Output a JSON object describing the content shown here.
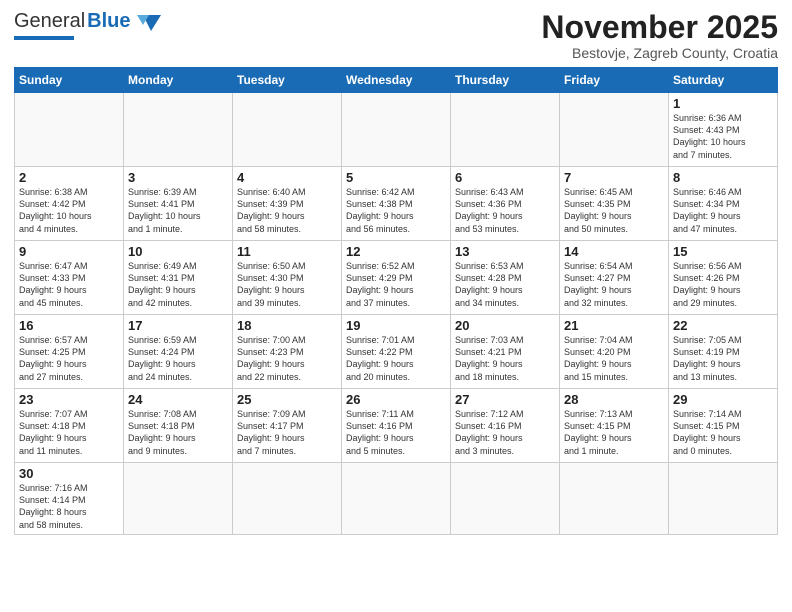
{
  "header": {
    "logo_general": "General",
    "logo_blue": "Blue",
    "month_title": "November 2025",
    "location": "Bestovje, Zagreb County, Croatia"
  },
  "days_of_week": [
    "Sunday",
    "Monday",
    "Tuesday",
    "Wednesday",
    "Thursday",
    "Friday",
    "Saturday"
  ],
  "weeks": [
    [
      {
        "day": "",
        "info": ""
      },
      {
        "day": "",
        "info": ""
      },
      {
        "day": "",
        "info": ""
      },
      {
        "day": "",
        "info": ""
      },
      {
        "day": "",
        "info": ""
      },
      {
        "day": "",
        "info": ""
      },
      {
        "day": "1",
        "info": "Sunrise: 6:36 AM\nSunset: 4:43 PM\nDaylight: 10 hours\nand 7 minutes."
      }
    ],
    [
      {
        "day": "2",
        "info": "Sunrise: 6:38 AM\nSunset: 4:42 PM\nDaylight: 10 hours\nand 4 minutes."
      },
      {
        "day": "3",
        "info": "Sunrise: 6:39 AM\nSunset: 4:41 PM\nDaylight: 10 hours\nand 1 minute."
      },
      {
        "day": "4",
        "info": "Sunrise: 6:40 AM\nSunset: 4:39 PM\nDaylight: 9 hours\nand 58 minutes."
      },
      {
        "day": "5",
        "info": "Sunrise: 6:42 AM\nSunset: 4:38 PM\nDaylight: 9 hours\nand 56 minutes."
      },
      {
        "day": "6",
        "info": "Sunrise: 6:43 AM\nSunset: 4:36 PM\nDaylight: 9 hours\nand 53 minutes."
      },
      {
        "day": "7",
        "info": "Sunrise: 6:45 AM\nSunset: 4:35 PM\nDaylight: 9 hours\nand 50 minutes."
      },
      {
        "day": "8",
        "info": "Sunrise: 6:46 AM\nSunset: 4:34 PM\nDaylight: 9 hours\nand 47 minutes."
      }
    ],
    [
      {
        "day": "9",
        "info": "Sunrise: 6:47 AM\nSunset: 4:33 PM\nDaylight: 9 hours\nand 45 minutes."
      },
      {
        "day": "10",
        "info": "Sunrise: 6:49 AM\nSunset: 4:31 PM\nDaylight: 9 hours\nand 42 minutes."
      },
      {
        "day": "11",
        "info": "Sunrise: 6:50 AM\nSunset: 4:30 PM\nDaylight: 9 hours\nand 39 minutes."
      },
      {
        "day": "12",
        "info": "Sunrise: 6:52 AM\nSunset: 4:29 PM\nDaylight: 9 hours\nand 37 minutes."
      },
      {
        "day": "13",
        "info": "Sunrise: 6:53 AM\nSunset: 4:28 PM\nDaylight: 9 hours\nand 34 minutes."
      },
      {
        "day": "14",
        "info": "Sunrise: 6:54 AM\nSunset: 4:27 PM\nDaylight: 9 hours\nand 32 minutes."
      },
      {
        "day": "15",
        "info": "Sunrise: 6:56 AM\nSunset: 4:26 PM\nDaylight: 9 hours\nand 29 minutes."
      }
    ],
    [
      {
        "day": "16",
        "info": "Sunrise: 6:57 AM\nSunset: 4:25 PM\nDaylight: 9 hours\nand 27 minutes."
      },
      {
        "day": "17",
        "info": "Sunrise: 6:59 AM\nSunset: 4:24 PM\nDaylight: 9 hours\nand 24 minutes."
      },
      {
        "day": "18",
        "info": "Sunrise: 7:00 AM\nSunset: 4:23 PM\nDaylight: 9 hours\nand 22 minutes."
      },
      {
        "day": "19",
        "info": "Sunrise: 7:01 AM\nSunset: 4:22 PM\nDaylight: 9 hours\nand 20 minutes."
      },
      {
        "day": "20",
        "info": "Sunrise: 7:03 AM\nSunset: 4:21 PM\nDaylight: 9 hours\nand 18 minutes."
      },
      {
        "day": "21",
        "info": "Sunrise: 7:04 AM\nSunset: 4:20 PM\nDaylight: 9 hours\nand 15 minutes."
      },
      {
        "day": "22",
        "info": "Sunrise: 7:05 AM\nSunset: 4:19 PM\nDaylight: 9 hours\nand 13 minutes."
      }
    ],
    [
      {
        "day": "23",
        "info": "Sunrise: 7:07 AM\nSunset: 4:18 PM\nDaylight: 9 hours\nand 11 minutes."
      },
      {
        "day": "24",
        "info": "Sunrise: 7:08 AM\nSunset: 4:18 PM\nDaylight: 9 hours\nand 9 minutes."
      },
      {
        "day": "25",
        "info": "Sunrise: 7:09 AM\nSunset: 4:17 PM\nDaylight: 9 hours\nand 7 minutes."
      },
      {
        "day": "26",
        "info": "Sunrise: 7:11 AM\nSunset: 4:16 PM\nDaylight: 9 hours\nand 5 minutes."
      },
      {
        "day": "27",
        "info": "Sunrise: 7:12 AM\nSunset: 4:16 PM\nDaylight: 9 hours\nand 3 minutes."
      },
      {
        "day": "28",
        "info": "Sunrise: 7:13 AM\nSunset: 4:15 PM\nDaylight: 9 hours\nand 1 minute."
      },
      {
        "day": "29",
        "info": "Sunrise: 7:14 AM\nSunset: 4:15 PM\nDaylight: 9 hours\nand 0 minutes."
      }
    ],
    [
      {
        "day": "30",
        "info": "Sunrise: 7:16 AM\nSunset: 4:14 PM\nDaylight: 8 hours\nand 58 minutes."
      },
      {
        "day": "",
        "info": ""
      },
      {
        "day": "",
        "info": ""
      },
      {
        "day": "",
        "info": ""
      },
      {
        "day": "",
        "info": ""
      },
      {
        "day": "",
        "info": ""
      },
      {
        "day": "",
        "info": ""
      }
    ]
  ]
}
